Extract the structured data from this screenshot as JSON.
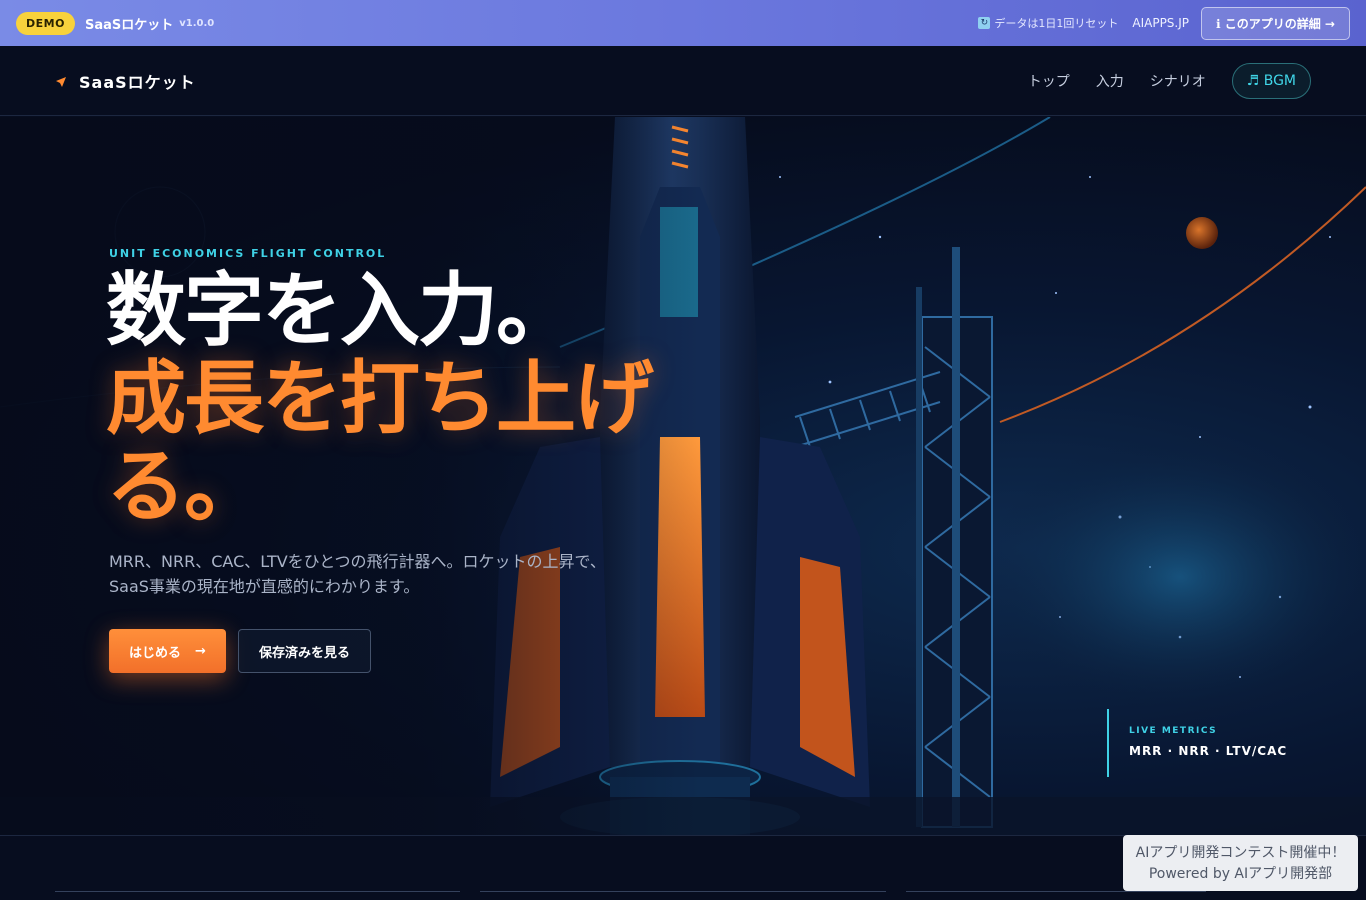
{
  "demo_bar": {
    "badge": "DEMO",
    "app_name": "SaaSロケット",
    "version": "v1.0.0",
    "reset_note": "データは1日1回リセット",
    "site_link": "AIAPPS.JP",
    "detail_button": "ℹ このアプリの詳細 →"
  },
  "nav": {
    "logo": "SaaSロケット",
    "links": [
      "トップ",
      "入力",
      "シナリオ"
    ],
    "bgm_button": "♬ BGM"
  },
  "hero": {
    "eyebrow": "UNIT ECONOMICS FLIGHT CONTROL",
    "title_line1": "数字を入力。",
    "title_line2": "成長を打ち上げる。",
    "subtitle_line1": "MRR、NRR、CAC、LTVをひとつの飛行計器へ。ロケットの上昇で、",
    "subtitle_line2": "SaaS事業の現在地が直感的にわかります。",
    "start_button": "はじめる",
    "start_arrow": "→",
    "saved_button": "保存済みを見る",
    "live_metrics_label": "LIVE METRICS",
    "live_metrics_value": "MRR · NRR · LTV/CAC"
  },
  "contest_banner": {
    "line1": "AIアプリ開発コンテスト開催中！",
    "line2": "Powered by AIアプリ開発部"
  },
  "colors": {
    "accent_orange": "#ff8a30",
    "accent_cyan": "#3fd2e6",
    "demo_badge": "#f8d23c",
    "background": "#070d1f"
  }
}
